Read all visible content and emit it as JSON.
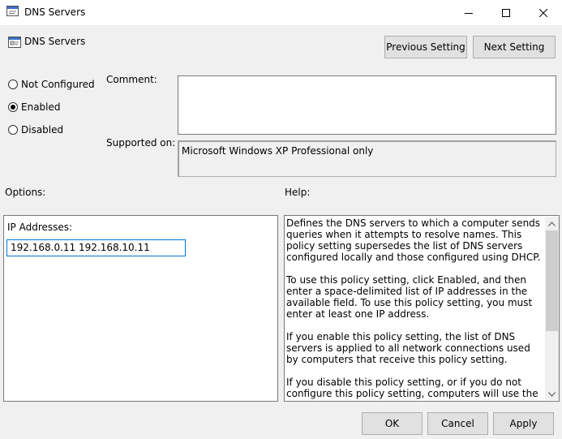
{
  "window": {
    "title": "DNS Servers",
    "controls": [
      "minimize-icon",
      "maximize-icon",
      "close-icon"
    ]
  },
  "header": {
    "title": "DNS Servers",
    "prev_label": "Previous Setting",
    "next_label": "Next Setting"
  },
  "state": {
    "options": [
      {
        "label": "Not Configured",
        "selected": false
      },
      {
        "label": "Enabled",
        "selected": true
      },
      {
        "label": "Disabled",
        "selected": false
      }
    ]
  },
  "comment": {
    "label": "Comment:",
    "value": ""
  },
  "supported": {
    "label": "Supported on:",
    "value": "Microsoft Windows XP Professional only"
  },
  "options_section": {
    "label": "Options:",
    "ip_label": "IP Addresses:",
    "ip_value": "192.168.0.11 192.168.10.11"
  },
  "help": {
    "label": "Help:",
    "paragraphs": [
      "Defines the DNS servers to which a computer sends queries when it attempts to resolve names. This policy setting supersedes the list of DNS servers configured locally and those configured using DHCP.",
      "To use this policy setting, click Enabled, and then enter a space-delimited list of IP addresses in the available field. To use this policy setting, you must enter at least one IP address.",
      "If you enable this policy setting, the list of DNS servers is applied to all network connections used by computers that receive this policy setting.",
      "If you disable this policy setting, or if you do not configure this policy setting, computers will use the local or DHCP configured parameters."
    ]
  },
  "footer": {
    "ok": "OK",
    "cancel": "Cancel",
    "apply": "Apply"
  },
  "colors": {
    "accent": "#0078d7",
    "button_bg": "#e1e1e1",
    "window_bg": "#f0f0f0"
  }
}
